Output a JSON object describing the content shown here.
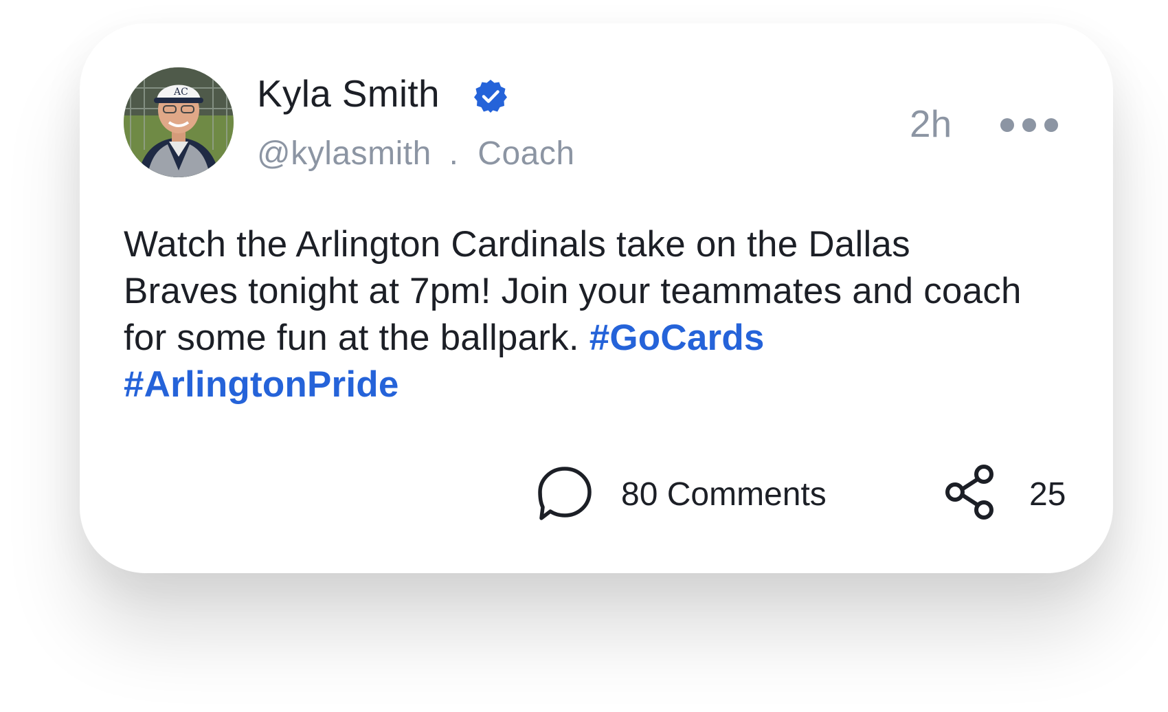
{
  "post": {
    "author_name": "Kyla Smith",
    "verified": true,
    "handle": "@kylasmith",
    "separator": ".",
    "role": "Coach",
    "time_ago": "2h",
    "text": "Watch the Arlington Cardinals take on the Dallas Braves tonight at 7pm! Join your teammates and coach for some fun at the ballpark.",
    "hashtags": [
      "#GoCards",
      "#ArlingtonPride"
    ],
    "comments_label": "80 Comments",
    "shares_count": "25"
  },
  "icons": {
    "verified": "verified-badge-icon",
    "more": "more-options-icon",
    "comment": "comment-bubble-icon",
    "share": "share-icon"
  },
  "colors": {
    "accent": "#2563d9",
    "text": "#1c1f26",
    "muted": "#8c95a3",
    "card": "#ffffff"
  }
}
